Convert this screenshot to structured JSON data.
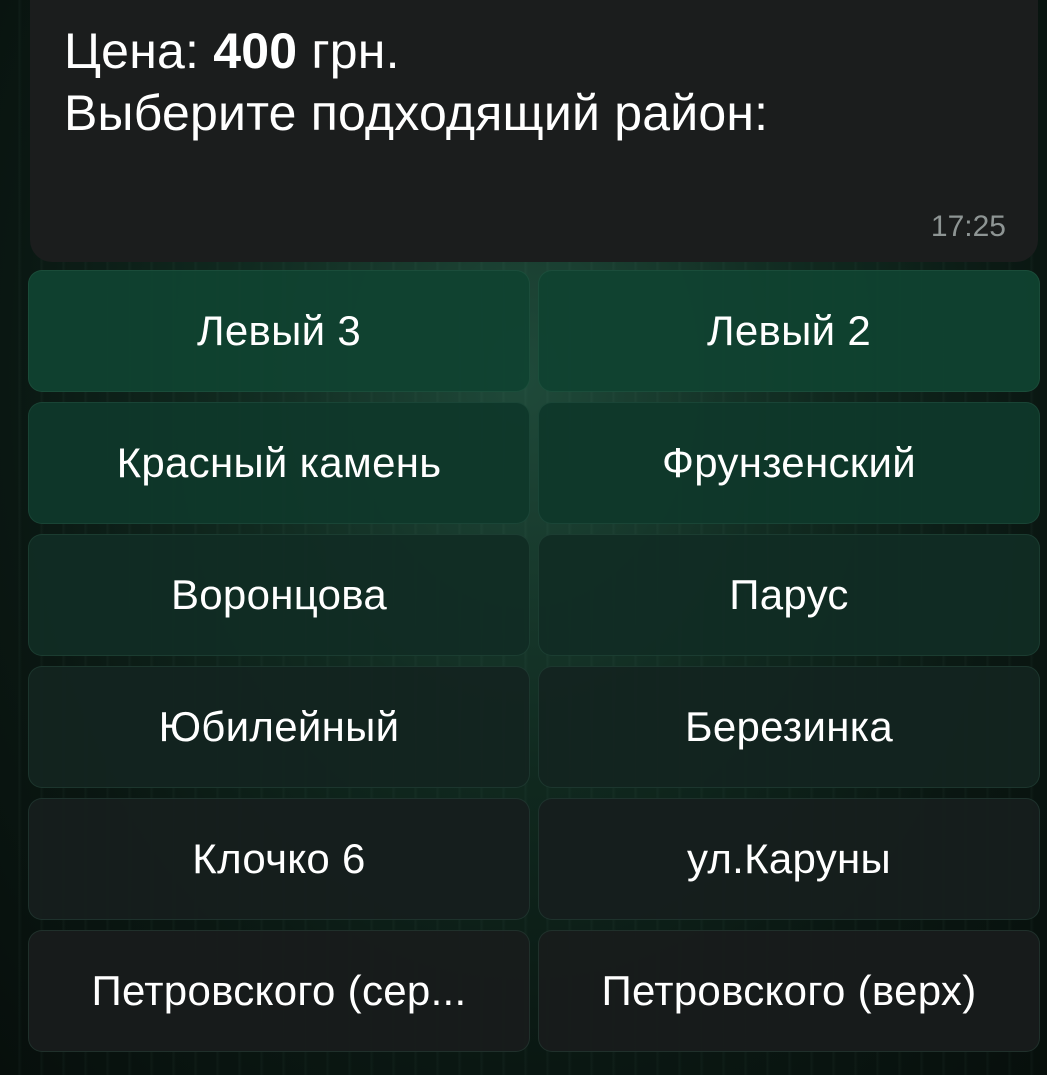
{
  "message": {
    "price_prefix": "Цена: ",
    "price_value": "400",
    "price_suffix": " грн.",
    "prompt": "Выберите подходящий район:",
    "time": "17:25"
  },
  "keyboard": {
    "buttons": [
      "Левый 3",
      "Левый 2",
      "Красный камень",
      "Фрунзенский",
      "Воронцова",
      "Парус",
      "Юбилейный",
      "Березинка",
      "Клочко 6",
      "ул.Каруны",
      "Петровского (сер...",
      "Петровского (верх)"
    ]
  }
}
